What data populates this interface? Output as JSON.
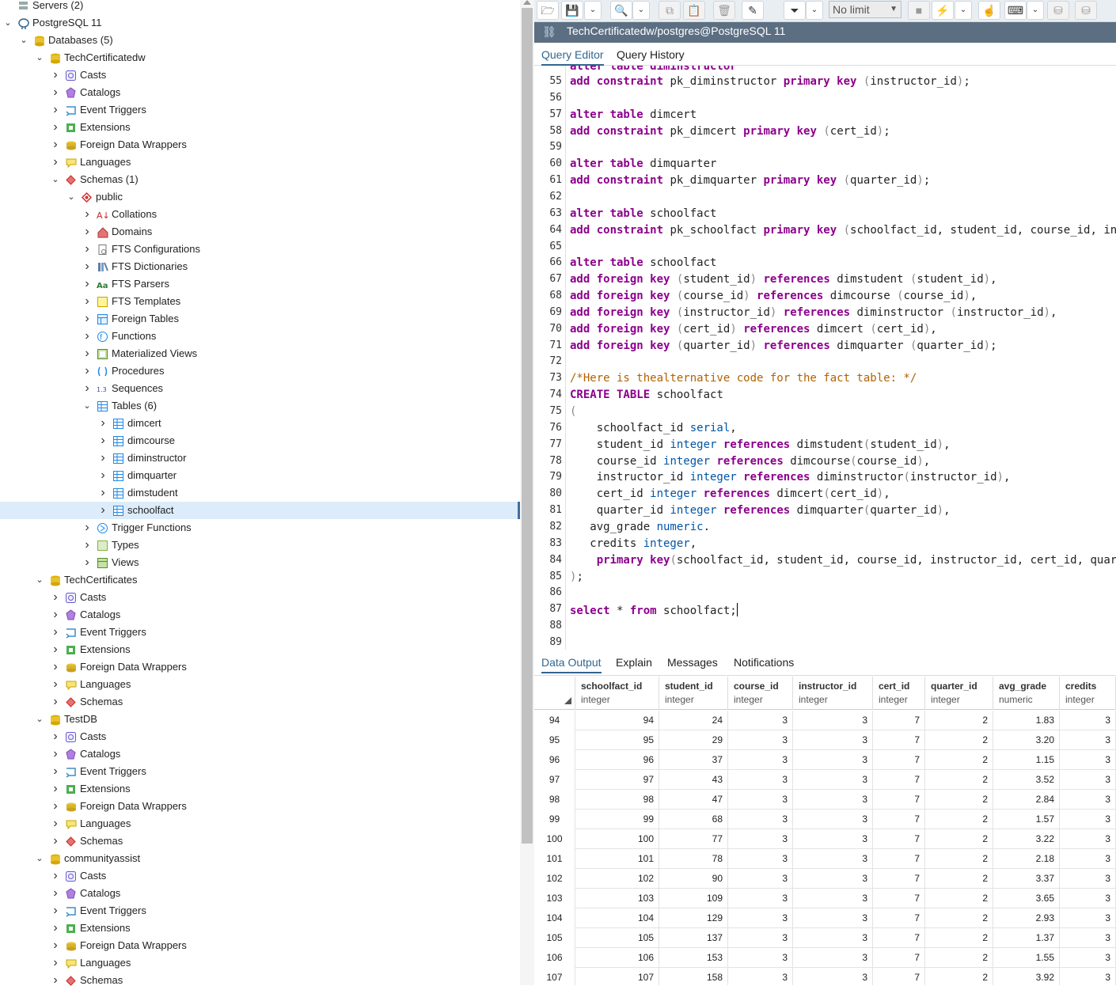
{
  "tree": {
    "items": [
      {
        "label": "Servers (2)",
        "depth": 0,
        "icon": "servers-icon",
        "chev": "none"
      },
      {
        "label": "PostgreSQL 11",
        "depth": 0,
        "icon": "postgres-elephant-icon",
        "chev": "down"
      },
      {
        "label": "Databases (5)",
        "depth": 1,
        "icon": "databases-icon",
        "chev": "down"
      },
      {
        "label": "TechCertificatedw",
        "depth": 2,
        "icon": "database-icon",
        "chev": "down"
      },
      {
        "label": "Casts",
        "depth": 3,
        "icon": "casts-icon",
        "chev": "right"
      },
      {
        "label": "Catalogs",
        "depth": 3,
        "icon": "catalogs-icon",
        "chev": "right"
      },
      {
        "label": "Event Triggers",
        "depth": 3,
        "icon": "event-triggers-icon",
        "chev": "right"
      },
      {
        "label": "Extensions",
        "depth": 3,
        "icon": "extensions-icon",
        "chev": "right"
      },
      {
        "label": "Foreign Data Wrappers",
        "depth": 3,
        "icon": "foreign-data-wrappers-icon",
        "chev": "right"
      },
      {
        "label": "Languages",
        "depth": 3,
        "icon": "languages-icon",
        "chev": "right"
      },
      {
        "label": "Schemas (1)",
        "depth": 3,
        "icon": "schemas-icon",
        "chev": "down"
      },
      {
        "label": "public",
        "depth": 4,
        "icon": "schema-icon",
        "chev": "down"
      },
      {
        "label": "Collations",
        "depth": 5,
        "icon": "collations-icon",
        "chev": "right"
      },
      {
        "label": "Domains",
        "depth": 5,
        "icon": "domains-icon",
        "chev": "right"
      },
      {
        "label": "FTS Configurations",
        "depth": 5,
        "icon": "fts-configurations-icon",
        "chev": "right"
      },
      {
        "label": "FTS Dictionaries",
        "depth": 5,
        "icon": "fts-dictionaries-icon",
        "chev": "right"
      },
      {
        "label": "FTS Parsers",
        "depth": 5,
        "icon": "fts-parsers-icon",
        "chev": "right"
      },
      {
        "label": "FTS Templates",
        "depth": 5,
        "icon": "fts-templates-icon",
        "chev": "right"
      },
      {
        "label": "Foreign Tables",
        "depth": 5,
        "icon": "foreign-tables-icon",
        "chev": "right"
      },
      {
        "label": "Functions",
        "depth": 5,
        "icon": "functions-icon",
        "chev": "right"
      },
      {
        "label": "Materialized Views",
        "depth": 5,
        "icon": "materialized-views-icon",
        "chev": "right"
      },
      {
        "label": "Procedures",
        "depth": 5,
        "icon": "procedures-icon",
        "chev": "right"
      },
      {
        "label": "Sequences",
        "depth": 5,
        "icon": "sequences-icon",
        "chev": "right"
      },
      {
        "label": "Tables (6)",
        "depth": 5,
        "icon": "tables-icon",
        "chev": "down"
      },
      {
        "label": "dimcert",
        "depth": 6,
        "icon": "table-icon",
        "chev": "right"
      },
      {
        "label": "dimcourse",
        "depth": 6,
        "icon": "table-icon",
        "chev": "right"
      },
      {
        "label": "diminstructor",
        "depth": 6,
        "icon": "table-icon",
        "chev": "right"
      },
      {
        "label": "dimquarter",
        "depth": 6,
        "icon": "table-icon",
        "chev": "right"
      },
      {
        "label": "dimstudent",
        "depth": 6,
        "icon": "table-icon",
        "chev": "right"
      },
      {
        "label": "schoolfact",
        "depth": 6,
        "icon": "table-icon",
        "chev": "right",
        "selected": true
      },
      {
        "label": "Trigger Functions",
        "depth": 5,
        "icon": "trigger-functions-icon",
        "chev": "right"
      },
      {
        "label": "Types",
        "depth": 5,
        "icon": "types-icon",
        "chev": "right"
      },
      {
        "label": "Views",
        "depth": 5,
        "icon": "views-icon",
        "chev": "right"
      },
      {
        "label": "TechCertificates",
        "depth": 2,
        "icon": "database-icon",
        "chev": "down"
      },
      {
        "label": "Casts",
        "depth": 3,
        "icon": "casts-icon",
        "chev": "right"
      },
      {
        "label": "Catalogs",
        "depth": 3,
        "icon": "catalogs-icon",
        "chev": "right"
      },
      {
        "label": "Event Triggers",
        "depth": 3,
        "icon": "event-triggers-icon",
        "chev": "right"
      },
      {
        "label": "Extensions",
        "depth": 3,
        "icon": "extensions-icon",
        "chev": "right"
      },
      {
        "label": "Foreign Data Wrappers",
        "depth": 3,
        "icon": "foreign-data-wrappers-icon",
        "chev": "right"
      },
      {
        "label": "Languages",
        "depth": 3,
        "icon": "languages-icon",
        "chev": "right"
      },
      {
        "label": "Schemas",
        "depth": 3,
        "icon": "schemas-icon",
        "chev": "right"
      },
      {
        "label": "TestDB",
        "depth": 2,
        "icon": "database-icon",
        "chev": "down"
      },
      {
        "label": "Casts",
        "depth": 3,
        "icon": "casts-icon",
        "chev": "right"
      },
      {
        "label": "Catalogs",
        "depth": 3,
        "icon": "catalogs-icon",
        "chev": "right"
      },
      {
        "label": "Event Triggers",
        "depth": 3,
        "icon": "event-triggers-icon",
        "chev": "right"
      },
      {
        "label": "Extensions",
        "depth": 3,
        "icon": "extensions-icon",
        "chev": "right"
      },
      {
        "label": "Foreign Data Wrappers",
        "depth": 3,
        "icon": "foreign-data-wrappers-icon",
        "chev": "right"
      },
      {
        "label": "Languages",
        "depth": 3,
        "icon": "languages-icon",
        "chev": "right"
      },
      {
        "label": "Schemas",
        "depth": 3,
        "icon": "schemas-icon",
        "chev": "right"
      },
      {
        "label": "communityassist",
        "depth": 2,
        "icon": "database-icon",
        "chev": "down"
      },
      {
        "label": "Casts",
        "depth": 3,
        "icon": "casts-icon",
        "chev": "right"
      },
      {
        "label": "Catalogs",
        "depth": 3,
        "icon": "catalogs-icon",
        "chev": "right"
      },
      {
        "label": "Event Triggers",
        "depth": 3,
        "icon": "event-triggers-icon",
        "chev": "right"
      },
      {
        "label": "Extensions",
        "depth": 3,
        "icon": "extensions-icon",
        "chev": "right"
      },
      {
        "label": "Foreign Data Wrappers",
        "depth": 3,
        "icon": "foreign-data-wrappers-icon",
        "chev": "right"
      },
      {
        "label": "Languages",
        "depth": 3,
        "icon": "languages-icon",
        "chev": "right"
      },
      {
        "label": "Schemas",
        "depth": 3,
        "icon": "schemas-icon",
        "chev": "right"
      }
    ]
  },
  "toolbar": {
    "buttons": [
      {
        "name": "open-file-button",
        "icon": "folder-open-icon",
        "glyph": "🗁"
      },
      {
        "name": "save-file-button",
        "icon": "save-icon",
        "glyph": "💾"
      },
      {
        "name": "save-dropdown-button",
        "icon": "chevron-down-icon",
        "glyph": "⌄"
      },
      {
        "name": "find-button",
        "icon": "search-icon",
        "glyph": "🔍"
      },
      {
        "name": "find-dropdown-button",
        "icon": "chevron-down-icon",
        "glyph": "⌄"
      },
      {
        "name": "copy-button",
        "icon": "copy-icon",
        "glyph": "⧉"
      },
      {
        "name": "paste-button",
        "icon": "paste-icon",
        "glyph": "📋"
      },
      {
        "name": "delete-button",
        "icon": "trash-icon",
        "glyph": "🗑"
      },
      {
        "name": "edit-button",
        "icon": "edit-icon",
        "glyph": "✎"
      },
      {
        "name": "filter-button",
        "icon": "filter-icon",
        "glyph": "⏷"
      },
      {
        "name": "filter-dropdown-button",
        "icon": "chevron-down-icon",
        "glyph": "⌄"
      },
      {
        "name": "stop-button",
        "icon": "stop-icon",
        "glyph": "■"
      },
      {
        "name": "execute-button",
        "icon": "lightning-icon",
        "glyph": "⚡"
      },
      {
        "name": "execute-dropdown-button",
        "icon": "chevron-down-icon",
        "glyph": "⌄"
      },
      {
        "name": "commit-button",
        "icon": "hand-pointer-icon",
        "glyph": "☝"
      },
      {
        "name": "macros-button",
        "icon": "keyboard-icon",
        "glyph": "⌨"
      },
      {
        "name": "macros-dropdown-button",
        "icon": "chevron-down-icon",
        "glyph": "⌄"
      },
      {
        "name": "commit-transaction-button",
        "icon": "database-commit-icon",
        "glyph": "⛁"
      },
      {
        "name": "rollback-transaction-button",
        "icon": "database-rollback-icon",
        "glyph": "⛁"
      }
    ],
    "limit_value": "No limit"
  },
  "connection": {
    "title": "TechCertificatedw/postgres@PostgreSQL 11",
    "icon": "connection-status-icon"
  },
  "editor_tabs": [
    "Query Editor",
    "Query History"
  ],
  "editor": {
    "partial_line_text": "alter table diminstructor",
    "lines": [
      {
        "n": "55",
        "html": "<span class=\"kw\">add constraint</span> pk_diminstructor <span class=\"kw\">primary key</span> <span class=\"pu\">(</span>instructor_id<span class=\"pu\">)</span>;"
      },
      {
        "n": "56",
        "html": ""
      },
      {
        "n": "57",
        "html": "<span class=\"kw\">alter table</span> dimcert"
      },
      {
        "n": "58",
        "html": "<span class=\"kw\">add constraint</span> pk_dimcert <span class=\"kw\">primary key</span> <span class=\"pu\">(</span>cert_id<span class=\"pu\">)</span>;"
      },
      {
        "n": "59",
        "html": ""
      },
      {
        "n": "60",
        "html": "<span class=\"kw\">alter table</span> dimquarter"
      },
      {
        "n": "61",
        "html": "<span class=\"kw\">add constraint</span> pk_dimquarter <span class=\"kw\">primary key</span> <span class=\"pu\">(</span>quarter_id<span class=\"pu\">)</span>;"
      },
      {
        "n": "62",
        "html": ""
      },
      {
        "n": "63",
        "html": "<span class=\"kw\">alter table</span> schoolfact"
      },
      {
        "n": "64",
        "html": "<span class=\"kw\">add constraint</span> pk_schoolfact <span class=\"kw\">primary key</span> <span class=\"pu\">(</span>schoolfact_id, student_id, course_id, in"
      },
      {
        "n": "65",
        "html": ""
      },
      {
        "n": "66",
        "html": "<span class=\"kw\">alter table</span> schoolfact"
      },
      {
        "n": "67",
        "html": "<span class=\"kw\">add foreign key</span> <span class=\"pu\">(</span>student_id<span class=\"pu\">)</span> <span class=\"kw\">references</span> dimstudent <span class=\"pu\">(</span>student_id<span class=\"pu\">)</span>,"
      },
      {
        "n": "68",
        "html": "<span class=\"kw\">add foreign key</span> <span class=\"pu\">(</span>course_id<span class=\"pu\">)</span> <span class=\"kw\">references</span> dimcourse <span class=\"pu\">(</span>course_id<span class=\"pu\">)</span>,"
      },
      {
        "n": "69",
        "html": "<span class=\"kw\">add foreign key</span> <span class=\"pu\">(</span>instructor_id<span class=\"pu\">)</span> <span class=\"kw\">references</span> diminstructor <span class=\"pu\">(</span>instructor_id<span class=\"pu\">)</span>,"
      },
      {
        "n": "70",
        "html": "<span class=\"kw\">add foreign key</span> <span class=\"pu\">(</span>cert_id<span class=\"pu\">)</span> <span class=\"kw\">references</span> dimcert <span class=\"pu\">(</span>cert_id<span class=\"pu\">)</span>,"
      },
      {
        "n": "71",
        "html": "<span class=\"kw\">add foreign key</span> <span class=\"pu\">(</span>quarter_id<span class=\"pu\">)</span> <span class=\"kw\">references</span> dimquarter <span class=\"pu\">(</span>quarter_id<span class=\"pu\">)</span>;"
      },
      {
        "n": "72",
        "html": ""
      },
      {
        "n": "73",
        "html": "<span class=\"cm\">/*Here is thealternative code for the fact table: */</span>"
      },
      {
        "n": "74",
        "html": "<span class=\"kw\">CREATE TABLE</span> schoolfact"
      },
      {
        "n": "75",
        "html": "<span class=\"pu\">(</span>"
      },
      {
        "n": "76",
        "html": "    schoolfact_id <span class=\"ty\">serial</span>,"
      },
      {
        "n": "77",
        "html": "    student_id <span class=\"ty\">integer</span> <span class=\"kw\">references</span> dimstudent<span class=\"pu\">(</span>student_id<span class=\"pu\">)</span>,"
      },
      {
        "n": "78",
        "html": "    course_id <span class=\"ty\">integer</span> <span class=\"kw\">references</span> dimcourse<span class=\"pu\">(</span>course_id<span class=\"pu\">)</span>,"
      },
      {
        "n": "79",
        "html": "    instructor_id <span class=\"ty\">integer</span> <span class=\"kw\">references</span> diminstructor<span class=\"pu\">(</span>instructor_id<span class=\"pu\">)</span>,"
      },
      {
        "n": "80",
        "html": "    cert_id <span class=\"ty\">integer</span> <span class=\"kw\">references</span> dimcert<span class=\"pu\">(</span>cert_id<span class=\"pu\">)</span>,"
      },
      {
        "n": "81",
        "html": "    quarter_id <span class=\"ty\">integer</span> <span class=\"kw\">references</span> dimquarter<span class=\"pu\">(</span>quarter_id<span class=\"pu\">)</span>,"
      },
      {
        "n": "82",
        "html": "   avg_grade <span class=\"ty\">numeric</span>."
      },
      {
        "n": "83",
        "html": "   credits <span class=\"ty\">integer</span>,"
      },
      {
        "n": "84",
        "html": "    <span class=\"kw\">primary key</span><span class=\"pu\">(</span>schoolfact_id, student_id, course_id, instructor_id, cert_id, quar"
      },
      {
        "n": "85",
        "html": "<span class=\"pu\">)</span>;"
      },
      {
        "n": "86",
        "html": ""
      },
      {
        "n": "87",
        "html": "<span class=\"kw\">select</span> * <span class=\"kw\">from</span> schoolfact;<span class=\"caret\"></span>"
      },
      {
        "n": "88",
        "html": ""
      },
      {
        "n": "89",
        "html": ""
      }
    ]
  },
  "output_tabs": [
    "Data Output",
    "Explain",
    "Messages",
    "Notifications"
  ],
  "grid": {
    "columns": [
      {
        "name": "schoolfact_id",
        "type": "integer"
      },
      {
        "name": "student_id",
        "type": "integer"
      },
      {
        "name": "course_id",
        "type": "integer"
      },
      {
        "name": "instructor_id",
        "type": "integer"
      },
      {
        "name": "cert_id",
        "type": "integer"
      },
      {
        "name": "quarter_id",
        "type": "integer"
      },
      {
        "name": "avg_grade",
        "type": "numeric"
      },
      {
        "name": "credits",
        "type": "integer"
      }
    ],
    "rows": [
      [
        "94",
        "94",
        "24",
        "3",
        "3",
        "7",
        "2",
        "1.83",
        "3"
      ],
      [
        "95",
        "95",
        "29",
        "3",
        "3",
        "7",
        "2",
        "3.20",
        "3"
      ],
      [
        "96",
        "96",
        "37",
        "3",
        "3",
        "7",
        "2",
        "1.15",
        "3"
      ],
      [
        "97",
        "97",
        "43",
        "3",
        "3",
        "7",
        "2",
        "3.52",
        "3"
      ],
      [
        "98",
        "98",
        "47",
        "3",
        "3",
        "7",
        "2",
        "2.84",
        "3"
      ],
      [
        "99",
        "99",
        "68",
        "3",
        "3",
        "7",
        "2",
        "1.57",
        "3"
      ],
      [
        "100",
        "100",
        "77",
        "3",
        "3",
        "7",
        "2",
        "3.22",
        "3"
      ],
      [
        "101",
        "101",
        "78",
        "3",
        "3",
        "7",
        "2",
        "2.18",
        "3"
      ],
      [
        "102",
        "102",
        "90",
        "3",
        "3",
        "7",
        "2",
        "3.37",
        "3"
      ],
      [
        "103",
        "103",
        "109",
        "3",
        "3",
        "7",
        "2",
        "3.65",
        "3"
      ],
      [
        "104",
        "104",
        "129",
        "3",
        "3",
        "7",
        "2",
        "2.93",
        "3"
      ],
      [
        "105",
        "105",
        "137",
        "3",
        "3",
        "7",
        "2",
        "1.37",
        "3"
      ],
      [
        "106",
        "106",
        "153",
        "3",
        "3",
        "7",
        "2",
        "1.55",
        "3"
      ],
      [
        "107",
        "107",
        "158",
        "3",
        "3",
        "7",
        "2",
        "3.92",
        "3"
      ]
    ]
  }
}
